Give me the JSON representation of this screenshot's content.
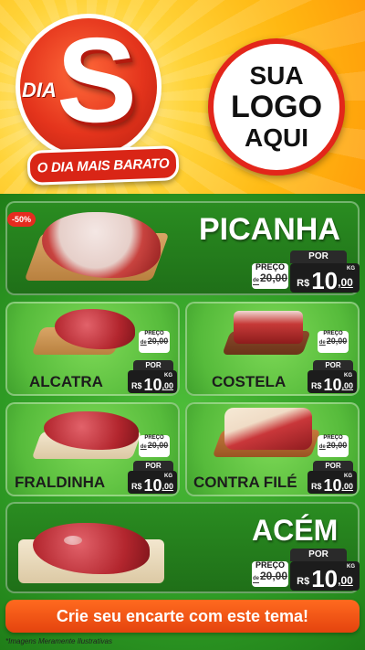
{
  "header": {
    "brand_prefix": "DIA",
    "brand_letter": "S",
    "tagline": "O DIA MAIS BARATO",
    "logo_line1": "SUA",
    "logo_line2": "LOGO",
    "logo_line3": "AQUI"
  },
  "discount_badge": "-50%",
  "labels": {
    "por": "POR",
    "preco": "PREÇO",
    "de": "de",
    "rs": "R$",
    "kg": "KG"
  },
  "products": [
    {
      "name": "PICANHA",
      "old_price": "20,00",
      "price_int": "10",
      "price_dec": ",00"
    },
    {
      "name": "ALCATRA",
      "old_price": "20,00",
      "price_int": "10",
      "price_dec": ",00"
    },
    {
      "name": "COSTELA",
      "old_price": "20,00",
      "price_int": "10",
      "price_dec": ",00"
    },
    {
      "name": "FRALDINHA",
      "old_price": "20,00",
      "price_int": "10",
      "price_dec": ",00"
    },
    {
      "name": "CONTRA FILÉ",
      "old_price": "20,00",
      "price_int": "10",
      "price_dec": ",00"
    },
    {
      "name": "ACÉM",
      "old_price": "20,00",
      "price_int": "10",
      "price_dec": ",00"
    }
  ],
  "cta": "Crie seu encarte com este tema!",
  "footnote": "*Imagens Meramente Ilustrativas",
  "colors": {
    "accent_red": "#e3261a",
    "green": "#2f9c25",
    "orange": "#ff6a1f",
    "yellow": "#ffd338"
  }
}
